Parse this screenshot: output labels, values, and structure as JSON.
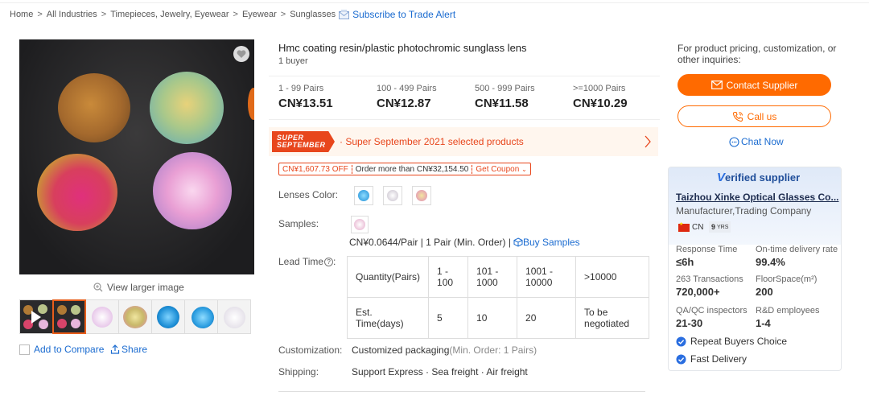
{
  "breadcrumb": {
    "items": [
      "Home",
      "All Industries",
      "Timepieces, Jewelry, Eyewear",
      "Eyewear",
      "Sunglasses"
    ],
    "separator": ">",
    "subscribe": "Subscribe to Trade Alert"
  },
  "gallery": {
    "view_larger": "View larger image",
    "add_to_compare": "Add to Compare",
    "share": "Share"
  },
  "product": {
    "title": "Hmc coating resin/plastic photochromic sunglass lens",
    "buyers": "1 buyer",
    "tiers": [
      {
        "qty": "1 - 99 Pairs",
        "price": "CN¥13.51"
      },
      {
        "qty": "100 - 499 Pairs",
        "price": "CN¥12.87"
      },
      {
        "qty": "500 - 999 Pairs",
        "price": "CN¥11.58"
      },
      {
        "qty": ">=1000 Pairs",
        "price": "CN¥10.29"
      }
    ],
    "promo": {
      "badge_line1": "SUPER",
      "badge_line2": "SEPTEMBER",
      "text": "· Super September 2021 selected products"
    },
    "coupon": {
      "off": "CN¥1,607.73 OFF",
      "condition": "Order more than CN¥32,154.50",
      "get": "Get Coupon"
    },
    "lenses_color_label": "Lenses Color:",
    "samples_label": "Samples:",
    "sample_price": "CN¥0.0644/Pair | 1 Pair (Min. Order) |",
    "buy_samples": "Buy Samples",
    "lead_time_label": "Lead Time",
    "lead_time_info": "?",
    "lead_table": {
      "quantity_label": "Quantity(Pairs)",
      "time_label": "Est. Time(days)",
      "ranges": [
        "1 - 100",
        "101 - 1000",
        "1001 - 10000",
        ">10000"
      ],
      "times": [
        "5",
        "10",
        "20",
        "To be negotiated"
      ]
    },
    "customization_label": "Customization:",
    "customization_value": "Customized packaging",
    "customization_note": "(Min. Order: 1 Pairs)",
    "shipping_label": "Shipping:",
    "shipping_value": "Support Express · Sea freight · Air freight"
  },
  "sidebar": {
    "inquiry_text": "For product pricing, customization, or other inquiries:",
    "contact_supplier": "Contact Supplier",
    "call_us": "Call us",
    "chat_now": "Chat Now",
    "verified": {
      "v": "V",
      "rest": "erified supplier"
    },
    "company_name": "Taizhou Xinke Optical Glasses Co...",
    "company_type": "Manufacturer,Trading Company",
    "country": "CN",
    "years": "9",
    "years_unit": "YRS",
    "metrics": [
      {
        "label": "Response Time",
        "value": "≤6h"
      },
      {
        "label": "On-time delivery rate",
        "value": "99.4%"
      },
      {
        "label": "263 Transactions",
        "value": "720,000+"
      },
      {
        "label": "FloorSpace(m²)",
        "value": "200"
      },
      {
        "label": "QA/QC inspectors",
        "value": "21-30"
      },
      {
        "label": "R&D employees",
        "value": "1-4"
      }
    ],
    "features": [
      "Repeat Buyers Choice",
      "Fast Delivery"
    ]
  },
  "colors": {
    "accent": "#ff6a00",
    "promo_red": "#e8461c",
    "link": "#1a6bd0"
  }
}
